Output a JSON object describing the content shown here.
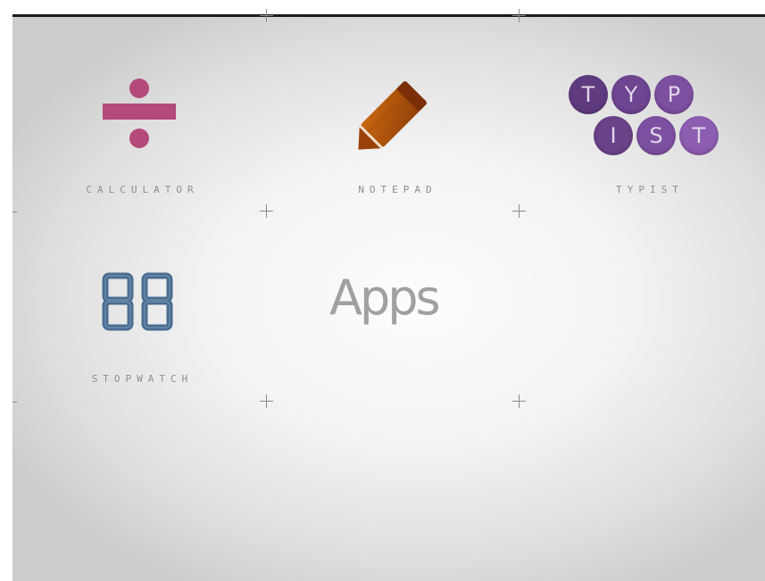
{
  "screen": {
    "title": "Apps"
  },
  "apps": [
    {
      "label": "CALCULATOR",
      "icon": "divide-icon"
    },
    {
      "label": "NOTEPAD",
      "icon": "pencil-icon"
    },
    {
      "label": "TYPIST",
      "icon": "typist-icon",
      "letters": [
        "T",
        "Y",
        "P",
        "I",
        "S",
        "T"
      ]
    },
    {
      "label": "STOPWATCH",
      "icon": "stopwatch-digits-icon",
      "digits": "88"
    }
  ],
  "colors": {
    "calculator": "#b34a7a",
    "notepad": "#b85a10",
    "typist_dark": "#5f3a7e",
    "typist_light": "#8c5db0",
    "stopwatch": "#4a6d90",
    "label": "#8e8e8e"
  }
}
